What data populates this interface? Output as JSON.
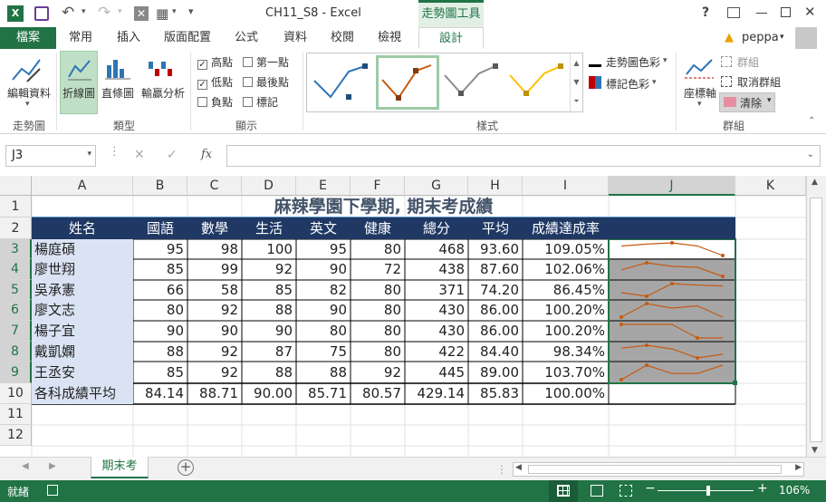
{
  "titlebar": {
    "title": "CH11_S8 - Excel",
    "context_tool": "走勢圖工具",
    "help": "?"
  },
  "tabs": [
    {
      "label": "檔案",
      "active": false,
      "file": true
    },
    {
      "label": "常用"
    },
    {
      "label": "插入"
    },
    {
      "label": "版面配置"
    },
    {
      "label": "公式"
    },
    {
      "label": "資料"
    },
    {
      "label": "校閱"
    },
    {
      "label": "檢視"
    },
    {
      "label": "設計",
      "active": true
    }
  ],
  "user": {
    "name": "peppa"
  },
  "ribbon": {
    "edit_data": "編輯資料",
    "sparkline_group": "走勢圖",
    "line": "折線圖",
    "column": "直條圖",
    "winloss": "輸贏分析",
    "type_group": "類型",
    "high": "高點",
    "low": "低點",
    "negative": "負點",
    "first": "第一點",
    "last": "最後點",
    "markers": "標記",
    "show_group": "顯示",
    "style_group": "樣式",
    "spark_color": "走勢圖色彩",
    "marker_color": "標記色彩",
    "axis": "座標軸",
    "group": "群組",
    "ungroup": "取消群組",
    "clear": "清除",
    "group_group": "群組"
  },
  "formula": {
    "namebox": "J3",
    "fx": "fx",
    "content": ""
  },
  "columns": [
    "A",
    "B",
    "C",
    "D",
    "E",
    "F",
    "G",
    "H",
    "I",
    "J",
    "K"
  ],
  "rows": [
    "1",
    "2",
    "3",
    "4",
    "5",
    "6",
    "7",
    "8",
    "9",
    "10",
    "11",
    "12"
  ],
  "sheet": {
    "title": "麻辣學園下學期, 期末考成績",
    "headers": [
      "姓名",
      "國語",
      "數學",
      "生活",
      "英文",
      "健康",
      "總分",
      "平均",
      "成績達成率"
    ],
    "data": [
      [
        "楊庭碩",
        "95",
        "98",
        "100",
        "95",
        "80",
        "468",
        "93.60",
        "109.05%"
      ],
      [
        "廖世翔",
        "85",
        "99",
        "92",
        "90",
        "72",
        "438",
        "87.60",
        "102.06%"
      ],
      [
        "吳承憲",
        "66",
        "58",
        "85",
        "82",
        "80",
        "371",
        "74.20",
        "86.45%"
      ],
      [
        "廖文志",
        "80",
        "92",
        "88",
        "90",
        "80",
        "430",
        "86.00",
        "100.20%"
      ],
      [
        "楊子宜",
        "90",
        "90",
        "90",
        "80",
        "80",
        "430",
        "86.00",
        "100.20%"
      ],
      [
        "戴凱嫻",
        "88",
        "92",
        "87",
        "75",
        "80",
        "422",
        "84.40",
        "98.34%"
      ],
      [
        "王丞安",
        "85",
        "92",
        "88",
        "88",
        "92",
        "445",
        "89.00",
        "103.70%"
      ]
    ],
    "avg": [
      "各科成績平均",
      "84.14",
      "88.71",
      "90.00",
      "85.71",
      "80.57",
      "429.14",
      "85.83",
      "100.00%"
    ]
  },
  "sparkline_values": [
    [
      95,
      98,
      100,
      95,
      80
    ],
    [
      85,
      99,
      92,
      90,
      72
    ],
    [
      66,
      58,
      85,
      82,
      80
    ],
    [
      80,
      92,
      88,
      90,
      80
    ],
    [
      90,
      90,
      90,
      80,
      80
    ],
    [
      88,
      92,
      87,
      75,
      80
    ],
    [
      85,
      92,
      88,
      88,
      92
    ]
  ],
  "sheet_tab": "期末考",
  "status": {
    "ready": "就緒",
    "zoom": "106%"
  },
  "colors": {
    "accent": "#217346",
    "header_fill": "#1f3864",
    "name_fill": "#dae3f3",
    "spark": "#c55a11",
    "spark_bg": "#a6a6a6"
  }
}
